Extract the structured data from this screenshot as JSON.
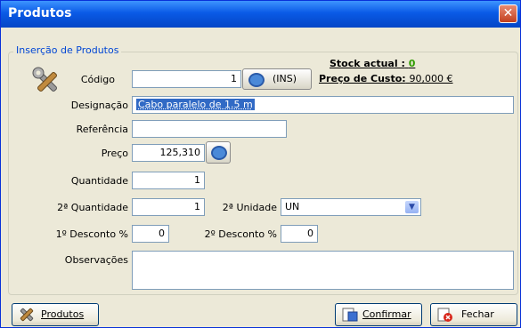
{
  "window": {
    "title": "Produtos",
    "close_label": "✕"
  },
  "group": {
    "legend": "Inserção de Produtos"
  },
  "stock": {
    "label": "Stock actual :",
    "value": "0",
    "cost_label": "Preço de Custo:",
    "cost_value": "90,000 €"
  },
  "fields": {
    "codigo": {
      "label": "Código",
      "value": "1",
      "search_button": "(INS)"
    },
    "designacao": {
      "label": "Designação",
      "value": "Cabo paralelo de 1.5 m"
    },
    "referencia": {
      "label": "Referência",
      "value": ""
    },
    "preco": {
      "label": "Preço",
      "value": "125,310"
    },
    "quantidade": {
      "label": "Quantidade",
      "value": "1"
    },
    "quantidade2": {
      "label": "2ª Quantidade",
      "value": "1"
    },
    "unidade2": {
      "label": "2ª Unidade",
      "value": "UN"
    },
    "desconto1": {
      "label": "1º Desconto %",
      "value": "0"
    },
    "desconto2": {
      "label": "2º Desconto %",
      "value": "0"
    },
    "observacoes": {
      "label": "Observações",
      "value": ""
    }
  },
  "buttons": {
    "produtos": "Produtos",
    "confirmar": "Confirmar",
    "fechar": "Fechar"
  },
  "colors": {
    "title_bar": "#0a5ae6",
    "group_legend": "#0046d5",
    "stock_value": "#2e9c00"
  }
}
